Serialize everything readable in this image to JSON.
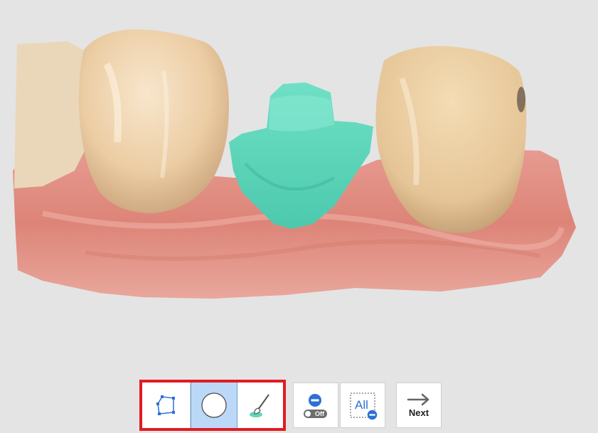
{
  "toolbar": {
    "tools": [
      {
        "icon": "polygon-select-icon",
        "active": false
      },
      {
        "icon": "circle-select-icon",
        "active": true
      },
      {
        "icon": "brush-select-icon",
        "active": false
      }
    ],
    "toggle_off_label": "Off",
    "select_all_label": "All",
    "next_label": "Next"
  },
  "colors": {
    "selection_border": "#e11b22",
    "active_tool_bg": "#bcd8f7",
    "selection_highlight": "#5fd6bb",
    "icon_blue": "#2e6fd6"
  }
}
